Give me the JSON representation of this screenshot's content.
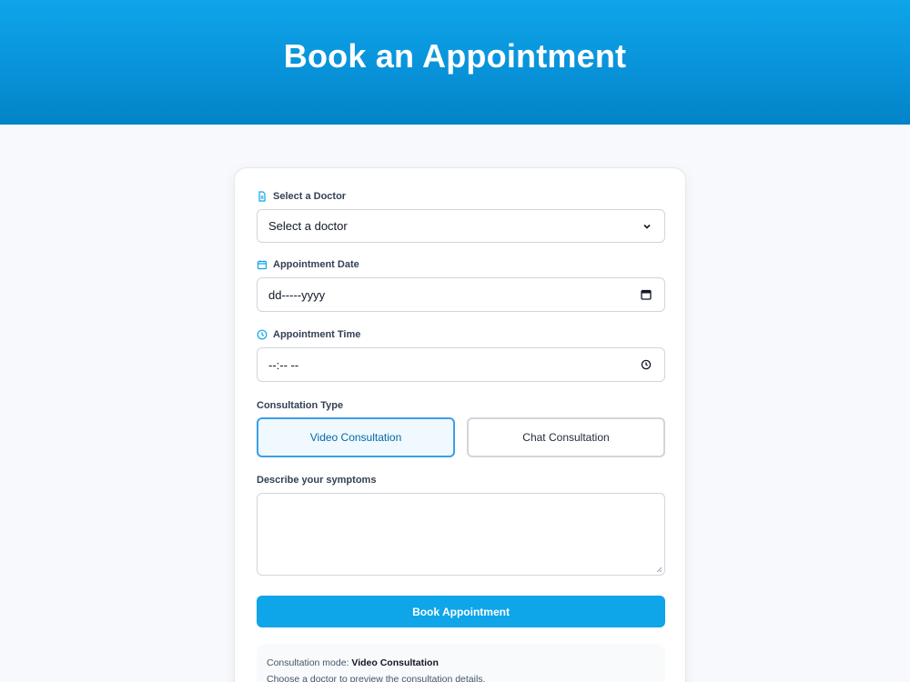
{
  "header": {
    "title": "Book an Appointment"
  },
  "form": {
    "doctor": {
      "label": "Select a Doctor",
      "value": "Select a doctor"
    },
    "date": {
      "label": "Appointment Date",
      "placeholder": "dd-----yyyy"
    },
    "time": {
      "label": "Appointment Time",
      "placeholder": "--:-- --"
    },
    "consultation": {
      "label": "Consultation Type",
      "options": [
        "Video Consultation",
        "Chat Consultation"
      ],
      "selected": "Video Consultation"
    },
    "symptoms": {
      "label": "Describe your symptoms",
      "value": ""
    },
    "submit_label": "Book Appointment"
  },
  "info": {
    "mode_label": "Consultation mode:",
    "mode_value": "Video Consultation",
    "hint": "Choose a doctor to preview the consultation details."
  },
  "colors": {
    "accent": "#0ea5e9",
    "header_gradient_end": "#0284c7",
    "active_border": "#3b9fe6"
  },
  "icons": {
    "doctor": "document-icon",
    "date": "calendar-icon",
    "time": "clock-icon"
  }
}
